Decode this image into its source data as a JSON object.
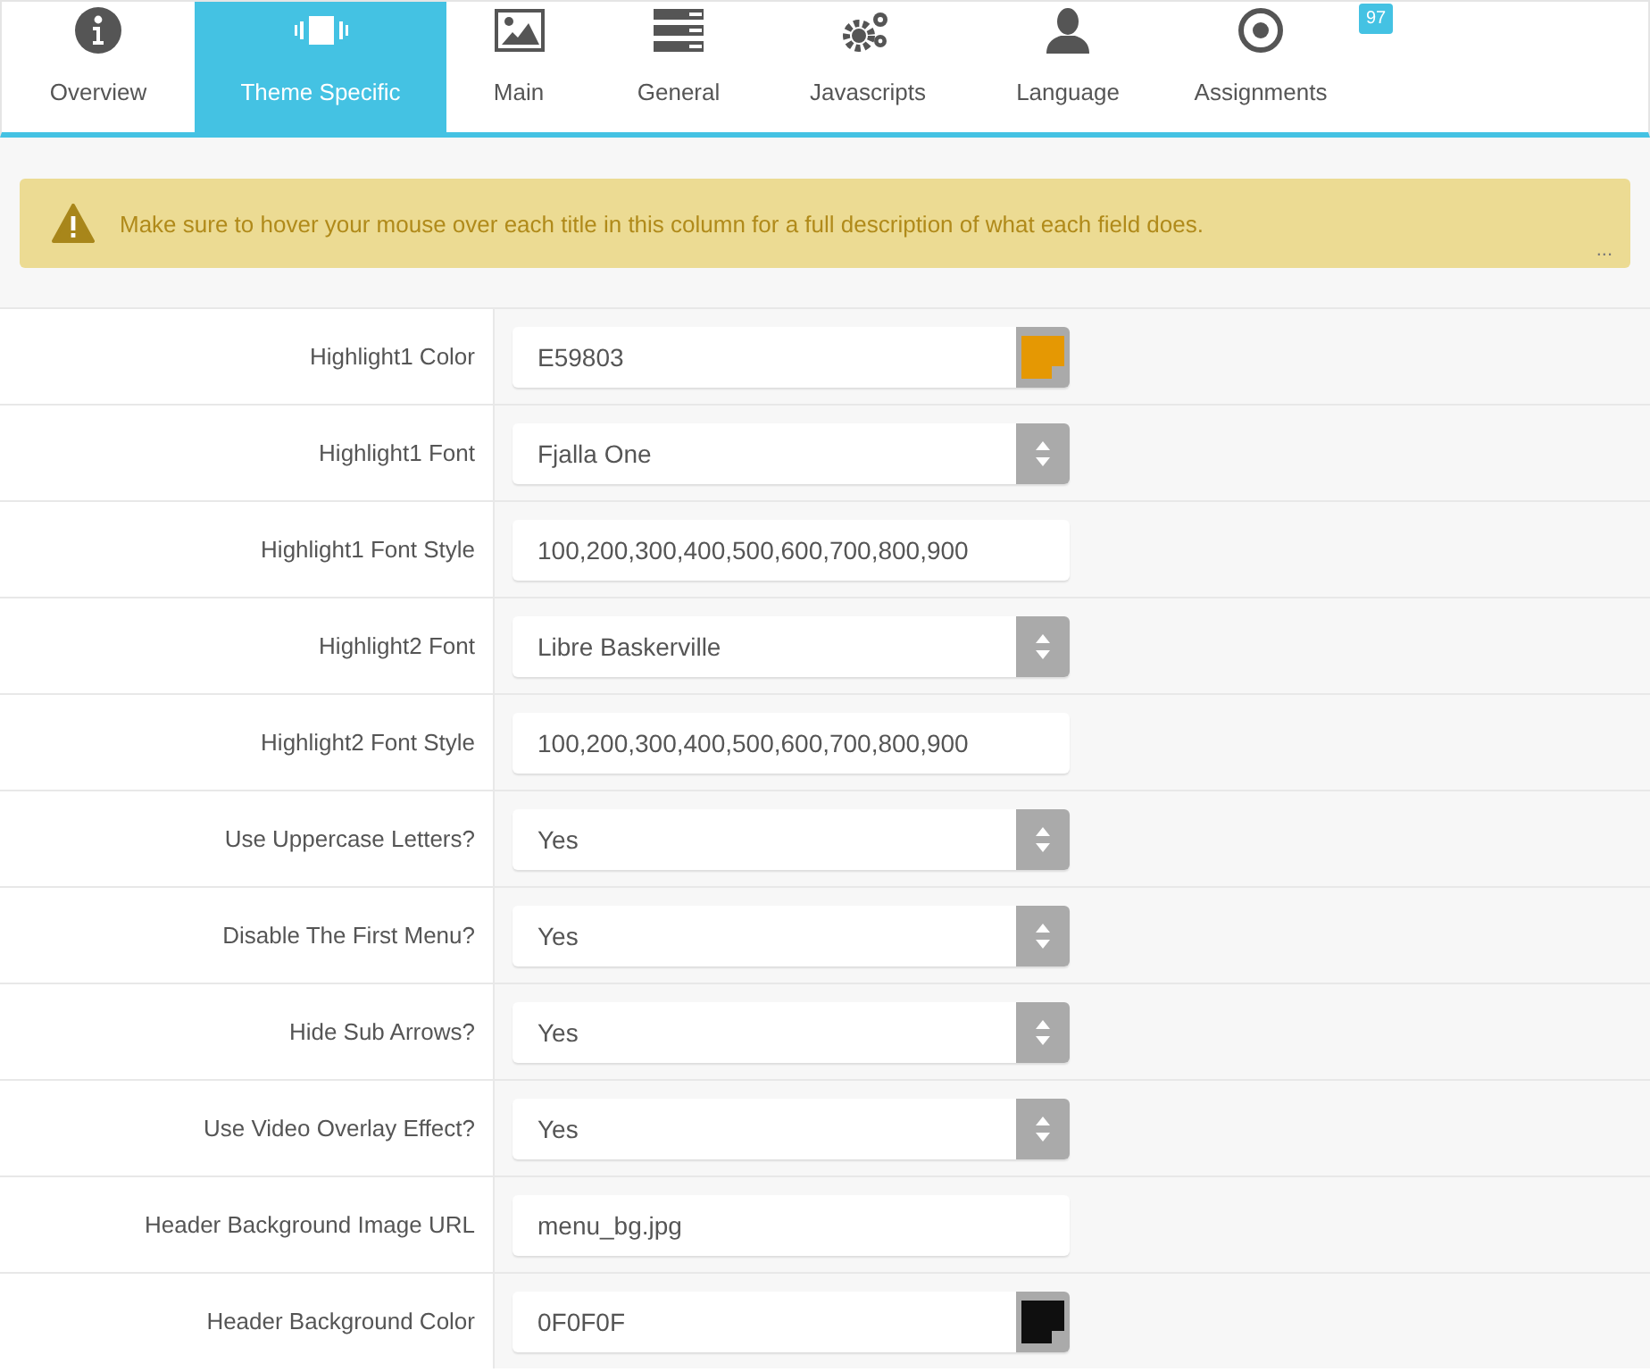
{
  "tabs": [
    {
      "label": "Overview",
      "selected": false
    },
    {
      "label": "Theme Specific",
      "selected": true
    },
    {
      "label": "Main",
      "selected": false
    },
    {
      "label": "General",
      "selected": false
    },
    {
      "label": "Javascripts",
      "selected": false
    },
    {
      "label": "Language",
      "selected": false
    },
    {
      "label": "Assignments",
      "selected": false,
      "badge": "97"
    }
  ],
  "alert": {
    "message": "Make sure to hover your mouse over each title in this column for a full description of what each field does.",
    "more": "..."
  },
  "fields": [
    {
      "label": "Highlight1 Color",
      "kind": "color",
      "value": "E59803"
    },
    {
      "label": "Highlight1 Font",
      "kind": "select",
      "value": "Fjalla One"
    },
    {
      "label": "Highlight1 Font Style",
      "kind": "text",
      "value": "100,200,300,400,500,600,700,800,900"
    },
    {
      "label": "Highlight2 Font",
      "kind": "select",
      "value": "Libre Baskerville"
    },
    {
      "label": "Highlight2 Font Style",
      "kind": "text",
      "value": "100,200,300,400,500,600,700,800,900"
    },
    {
      "label": "Use Uppercase Letters?",
      "kind": "select",
      "value": "Yes"
    },
    {
      "label": "Disable The First Menu?",
      "kind": "select",
      "value": "Yes"
    },
    {
      "label": "Hide Sub Arrows?",
      "kind": "select",
      "value": "Yes"
    },
    {
      "label": "Use Video Overlay Effect?",
      "kind": "select",
      "value": "Yes"
    },
    {
      "label": "Header Background Image URL",
      "kind": "text",
      "value": "menu_bg.jpg"
    },
    {
      "label": "Header Background Color",
      "kind": "color",
      "value": "0F0F0F"
    }
  ]
}
